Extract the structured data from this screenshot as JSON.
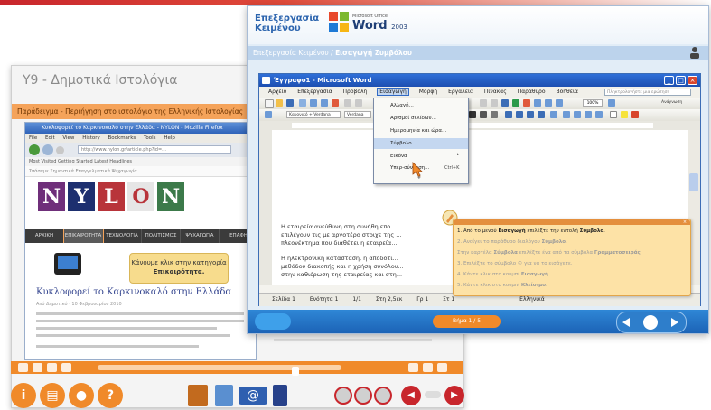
{
  "back_window": {
    "title": "Υ9 - Δημοτικά Ιστολόγια",
    "breadcrumb": "Παράδειγμα - Περιήγηση στο ιστολόγιο της Ελληνικής Ιστολογίας",
    "browser": {
      "title": "Κυκλοφορεί το Καρκινοκαλό στην Ελλάδα - NYLON - Mozilla Firefox",
      "menu": [
        "File",
        "Edit",
        "View",
        "History",
        "Bookmarks",
        "Tools",
        "Help"
      ],
      "address": "http://www.nylon.gr/article.php?id=...",
      "favorites_bar": "Most Visited   Getting Started   Latest Headlines",
      "tabs_bar": "Σπάσαμε   Σημαντικά   Επαγγελματικά   Ψυχαγωγία",
      "logo_letters": [
        "N",
        "Y",
        "L",
        "O",
        "N"
      ],
      "nav": [
        "ΑΡΧΙΚΗ",
        "ΕΠΙΚΑΙΡΟΤΗΤΑ",
        "ΤΕΧΝΟΛΟΓΙΑ",
        "ΠΟΛΙΤΙΣΜΟΣ",
        "ΨΥΧΑΓΩΓΙΑ",
        "ΕΠΑΦΗ"
      ],
      "tooltip_line1": "Κάνουμε κλικ στην κατηγορία",
      "tooltip_line2": "Επικαιρότητα.",
      "post_title": "Κυκλοφορεί το Καρκινοκαλό στην Ελλάδα",
      "post_meta": "Από Δημοτικό · 10 Φεβρουαρίου 2010"
    }
  },
  "front_window": {
    "app_title": "Επεξεργασία\nΚειμένου",
    "office_small": "Microsoft Office",
    "word_label": "Word",
    "word_version": "2003",
    "breadcrumb_prefix": "Επεξεργασία Κειμένου /",
    "breadcrumb_current": "Εισαγωγή Συμβόλου",
    "word": {
      "title": "Έγγραφο1 - Microsoft Word",
      "menu": [
        "Αρχείο",
        "Επεξεργασία",
        "Προβολή",
        "Εισαγωγή",
        "Μορφή",
        "Εργαλεία",
        "Πίνακας",
        "Παράθυρο",
        "Βοήθεια"
      ],
      "menu_selected_index": 3,
      "ask_placeholder": "Πληκτρολογήστε μια ερώτηση",
      "style_box": "Κανονικό + Verdana",
      "font_box": "Verdana",
      "zoom": "100%",
      "reading": "Ανάγνωση",
      "dropdown": {
        "items": [
          "Αλλαγή...",
          "Αριθμοί σελίδων...",
          "Ημερομηνία και ώρα...",
          "Σύμβολο...",
          "Εικόνα",
          "Υπερ-σύνδεση..."
        ],
        "highlight_index": 3,
        "hyperlink_shortcut": "Ctrl+K",
        "more": "¥"
      },
      "doc_lines": [
        "Η εταιρεία ανεύθυνη στη συνήθη επο...",
        "επιλέγουν τις με αργοτέρο στοιχε της ...",
        "πλεονέκτημα που διαθέτει η εταιρεία...",
        "",
        "Η ηλεκτρονική κατάσταση, η αποδοτι...",
        "μεθόδου διακοπής και η χρήση συνόλου...",
        "στην καθιέρωση της εταιρείας και στη..."
      ],
      "status": [
        "Σελίδα 1",
        "Ενότητα 1",
        "1/1",
        "Στη 2,5εκ",
        "Γρ 1",
        "Στ 1",
        "Ελληνικά"
      ]
    },
    "steps": [
      {
        "pre": "1. Από το μενού ",
        "bold": "Εισαγωγή",
        "mid": " επιλέξτε την εντολή ",
        "bold2": "Σύμβολο",
        "post": "."
      },
      {
        "pre": "2. Ανοίγει το παράθυρο διαλόγου ",
        "bold": "Σύμβολο",
        "mid": "",
        "bold2": "",
        "post": "."
      },
      {
        "pre": "   Στην καρτέλα ",
        "bold": "Σύμβολα",
        "mid": " επιλέξτε ένα από τα σύμβολα ",
        "bold2": "Γραμματοσειράς",
        "post": ""
      },
      {
        "pre": "3. Επιλέξτε το σύμβολο © για να το εισάγετε.",
        "bold": "",
        "mid": "",
        "bold2": "",
        "post": ""
      },
      {
        "pre": "4. Κάντε κλικ στο κουμπί ",
        "bold": "Εισαγωγή",
        "mid": "",
        "bold2": "",
        "post": "."
      },
      {
        "pre": "5. Κάντε κλικ στο κουμπί ",
        "bold": "Κλείσιμο",
        "mid": "",
        "bold2": "",
        "post": "."
      }
    ],
    "bottom_center": "Βήμα 1 / 5"
  },
  "colors": {
    "accent_orange": "#f08a2a",
    "accent_red": "#c8262c",
    "word_blue": "#1d4fb1"
  },
  "icons": [
    "info-icon",
    "book-icon",
    "user-icon",
    "help-icon",
    "library-icon",
    "notes-icon",
    "email-icon",
    "document-icon",
    "record-icon",
    "previous-icon",
    "next-icon"
  ]
}
